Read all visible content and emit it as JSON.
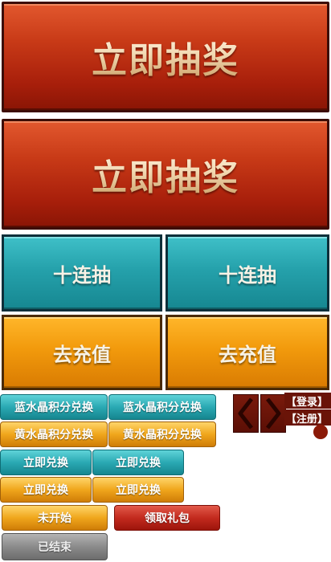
{
  "draw_buttons": [
    {
      "label": "立即抽奖"
    },
    {
      "label": "立即抽奖"
    }
  ],
  "ten_draw_buttons": [
    {
      "label": "十连抽"
    },
    {
      "label": "十连抽"
    }
  ],
  "recharge_buttons": [
    {
      "label": "去充值"
    },
    {
      "label": "去充值"
    }
  ],
  "blue_crystal_buttons": [
    {
      "label": "蓝水晶积分兑换"
    },
    {
      "label": "蓝水晶积分兑换"
    }
  ],
  "yellow_crystal_buttons": [
    {
      "label": "黄水晶积分兑换"
    },
    {
      "label": "黄水晶积分兑换"
    }
  ],
  "redeem_teal_buttons": [
    {
      "label": "立即兑换"
    },
    {
      "label": "立即兑换"
    }
  ],
  "redeem_gold_buttons": [
    {
      "label": "立即兑换"
    },
    {
      "label": "立即兑换"
    }
  ],
  "status_buttons": {
    "not_started": "未开始",
    "claim_gift": "领取礼包",
    "ended": "已结束"
  },
  "auth_links": {
    "login": "【登录】",
    "register": "【注册】"
  },
  "icons": {
    "prev": "chevron-left-icon",
    "next": "chevron-right-icon"
  },
  "colors": {
    "red": "#c83a17",
    "teal": "#25a1ab",
    "orange": "#f29a0c",
    "grey": "#8b8b8b"
  }
}
